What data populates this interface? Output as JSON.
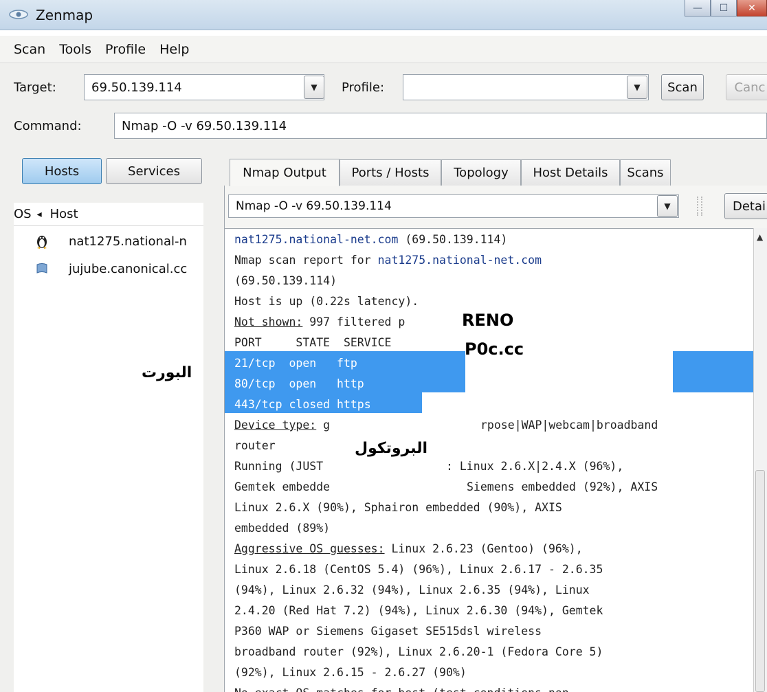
{
  "window": {
    "title": "Zenmap",
    "controls": {
      "minimize": "—",
      "maximize": "☐",
      "close": "✕"
    }
  },
  "menu": [
    "Scan",
    "Tools",
    "Profile",
    "Help"
  ],
  "toolbar": {
    "target_label": "Target:",
    "target_value": "69.50.139.114",
    "profile_label": "Profile:",
    "profile_value": "",
    "scan_button": "Scan",
    "cancel_button": "Canc",
    "command_label": "Command:",
    "command_value": "Nmap -O -v 69.50.139.114"
  },
  "left_panel": {
    "hosts_button": "Hosts",
    "services_button": "Services",
    "col_os": "OS",
    "col_sort_arrow": "◂",
    "col_host": "Host",
    "hosts": [
      {
        "name": "nat1275.national-n",
        "icon": "linux-penguin-icon"
      },
      {
        "name": "jujube.canonical.cc",
        "icon": "unknown-os-icon"
      }
    ]
  },
  "tabs": [
    "Nmap Output",
    "Ports / Hosts",
    "Topology",
    "Host Details",
    "Scans"
  ],
  "output_selector": {
    "value": "Nmap -O -v 69.50.139.114",
    "details_button": "Detai"
  },
  "output": {
    "l1_link": "nat1275.national-net.com",
    "l1_rest": " (69.50.139.114)",
    "l2_pre": "Nmap scan report for ",
    "l2_link": "nat1275.national-net.com",
    "l3": "(69.50.139.114)",
    "l4": "Host is up (0.22s latency).",
    "l5_u": "Not shown:",
    "l5_rest": " 997 filtered p",
    "l6": "PORT     STATE  SERVICE",
    "l7": "21/tcp  open   ftp",
    "l8": "80/tcp  open   http",
    "l9": "443/tcp closed https",
    "l10_u": "Device type:",
    "l10_a": " g",
    "l10_b": "rpose|WAP|webcam|broadband",
    "l11": "router",
    "l12_a": "Running (JUST ",
    "l12_b": ": Linux 2.6.X|2.4.X (96%),",
    "l13_a": "Gemtek embedde",
    "l13_b": "Siemens embedded (92%), AXIS",
    "l14": "Linux 2.6.X (90%), Sphairon embedded (90%), AXIS",
    "l15": "embedded (89%)",
    "l16_u": "Aggressive OS guesses:",
    "l16_rest": " Linux 2.6.23 (Gentoo) (96%),",
    "l17": "Linux 2.6.18 (CentOS 5.4) (96%), Linux 2.6.17 - 2.6.35",
    "l18": "(94%), Linux 2.6.32 (94%), Linux 2.6.35 (94%), Linux",
    "l19": "2.4.20 (Red Hat 7.2) (94%), Linux 2.6.30 (94%), Gemtek",
    "l20": "P360 WAP or Siemens Gigaset SE515dsl wireless",
    "l21": "broadband router (92%), Linux 2.6.20-1 (Fedora Core 5)",
    "l22": "(92%), Linux 2.6.15 - 2.6.27 (90%)",
    "l23": "No exact OS matches for host (test conditions non-"
  },
  "annotations": {
    "reno": "RENO",
    "poc": "P0c.cc",
    "port_ar": "البورت",
    "protocol_ar": "البروتكول"
  },
  "colors": {
    "highlight": "#3f99ef",
    "link": "#1b3c8c"
  }
}
